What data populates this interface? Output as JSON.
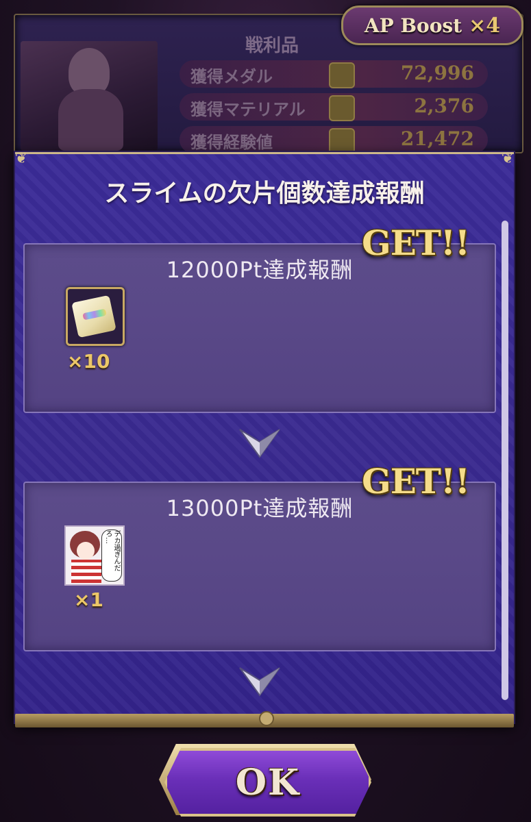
{
  "header": {
    "ap_boost_label": "AP Boost",
    "ap_boost_multiplier": "×4"
  },
  "loot": {
    "title": "戦利品",
    "rows": [
      {
        "name": "獲得メダル",
        "icon": "medal-icon",
        "value": "72,996"
      },
      {
        "name": "獲得マテリアル",
        "icon": "material-icon",
        "value": "2,376"
      },
      {
        "name": "獲得経験値",
        "icon": "exp-icon",
        "value": "21,472"
      }
    ]
  },
  "modal": {
    "title": "スライムの欠片個数達成報酬",
    "rewards": [
      {
        "heading": "12000Pt達成報酬",
        "badge": "GET!!",
        "item_icon": "gem-case-icon",
        "quantity": "×10"
      },
      {
        "heading": "13000Pt達成報酬",
        "badge": "GET!!",
        "item_icon": "character-sticker-icon",
        "item_text": "デカ過ぎんだろ…",
        "quantity": "×1"
      }
    ]
  },
  "ok_button": {
    "label": "OK"
  },
  "colors": {
    "modal_bg": "#3b2b98",
    "card_bg": "#5c4c8a",
    "gold": "#ecc768",
    "ok_purple": "#6a2fb8"
  }
}
